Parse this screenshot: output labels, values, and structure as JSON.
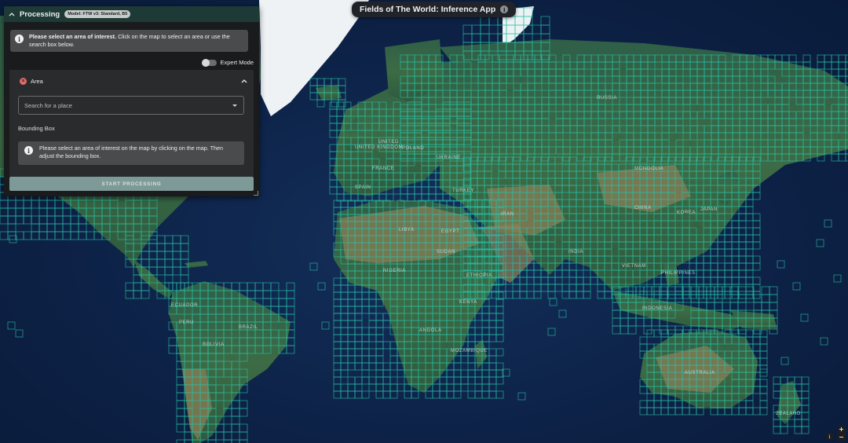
{
  "title_bar": {
    "title": "Fields of The World: Inference App"
  },
  "panel": {
    "title": "Processing",
    "model_badge": "Model: FTW v3: Standard, B5",
    "alert_bold": "Please select an area of interest.",
    "alert_text": " Click on the map to select an area or use the search box below.",
    "expert_mode_label": "Expert Mode",
    "expert_mode_on": false,
    "area": {
      "label": "Area",
      "search_placeholder": "Search for a place",
      "bbox_label": "Bounding Box",
      "bbox_info": "Please select an area of interest on the map by clicking on the map. Then adjust the bounding box."
    },
    "start_button": "START PROCESSING"
  },
  "map_controls": {
    "zoom_in": "+",
    "zoom_out": "−",
    "attribution": "i"
  },
  "map_labels": [
    "UNITED KINGDOM",
    "UNITED",
    "RUSSIA",
    "MONGOLIA",
    "CHINA",
    "INDIA",
    "SUDAN",
    "LIBYA",
    "EGYPT",
    "NIGERIA",
    "ETHIOPIA",
    "KENYA",
    "BRAZIL",
    "PERU",
    "BOLIVIA",
    "ECUADOR",
    "INDONESIA",
    "PHILIPPINES",
    "VIETNAM",
    "AUSTRALIA",
    "ZEALAND",
    "ANGOLA",
    "MOZAMBIQUE",
    "KOREA",
    "JAPAN",
    "TURKEY",
    "IRAN",
    "FRANCE",
    "SPAIN",
    "POLAND",
    "UKRAINE"
  ],
  "colors": {
    "panel_bg": "#1a1b1d",
    "panel_header": "#1e3a36",
    "grid_stroke": "#27c0a4",
    "ocean": "#0d2247",
    "start_button": "#7e9a98"
  }
}
